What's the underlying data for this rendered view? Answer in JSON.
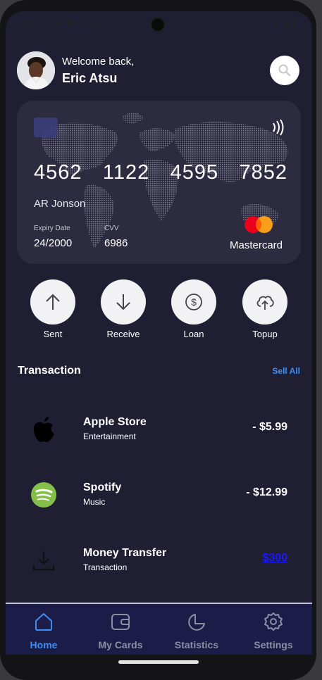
{
  "status_bar": {
    "time": "6:02",
    "icons": [
      "fan-icon",
      "m-icon",
      "shield-icon",
      "g-icon",
      "dot-icon"
    ],
    "right_icons": [
      "wifi-icon",
      "signal-icon",
      "battery-icon"
    ]
  },
  "header": {
    "welcome": "Welcome back,",
    "name": "Eric Atsu"
  },
  "card": {
    "number_groups": [
      "4562",
      "1122",
      "4595",
      "7852"
    ],
    "holder": "AR Jonson",
    "expiry_label": "Expiry Date",
    "expiry_value": "24/2000",
    "cvv_label": "CVV",
    "cvv_value": "6986",
    "brand": "Mastercard"
  },
  "actions": [
    {
      "label": "Sent",
      "icon": "arrow-up-icon"
    },
    {
      "label": "Receive",
      "icon": "arrow-down-icon"
    },
    {
      "label": "Loan",
      "icon": "dollar-icon"
    },
    {
      "label": "Topup",
      "icon": "cloud-upload-icon"
    }
  ],
  "transactions_section": {
    "title": "Transaction",
    "see_all": "Sell All"
  },
  "transactions": [
    {
      "name": "Apple Store",
      "category": "Entertainment",
      "amount": "- $5.99",
      "icon": "apple-icon"
    },
    {
      "name": "Spotify",
      "category": "Music",
      "amount": "- $12.99",
      "icon": "spotify-icon"
    },
    {
      "name": "Money Transfer",
      "category": "Transaction",
      "amount": "$300",
      "icon": "download-icon"
    }
  ],
  "nav": [
    {
      "label": "Home",
      "icon": "home-icon",
      "active": true
    },
    {
      "label": "My Cards",
      "icon": "wallet-icon",
      "active": false
    },
    {
      "label": "Statistics",
      "icon": "pie-chart-icon",
      "active": false
    },
    {
      "label": "Settings",
      "icon": "gear-icon",
      "active": false
    }
  ],
  "colors": {
    "background": "#1f1e33",
    "accent": "#3d8ef0",
    "card": "#2c2b40",
    "navbar": "#1c1c48",
    "link": "#1a1aff",
    "mastercard_red": "#eb001b",
    "mastercard_orange": "#f79e1b",
    "spotify_green": "#1db954"
  }
}
